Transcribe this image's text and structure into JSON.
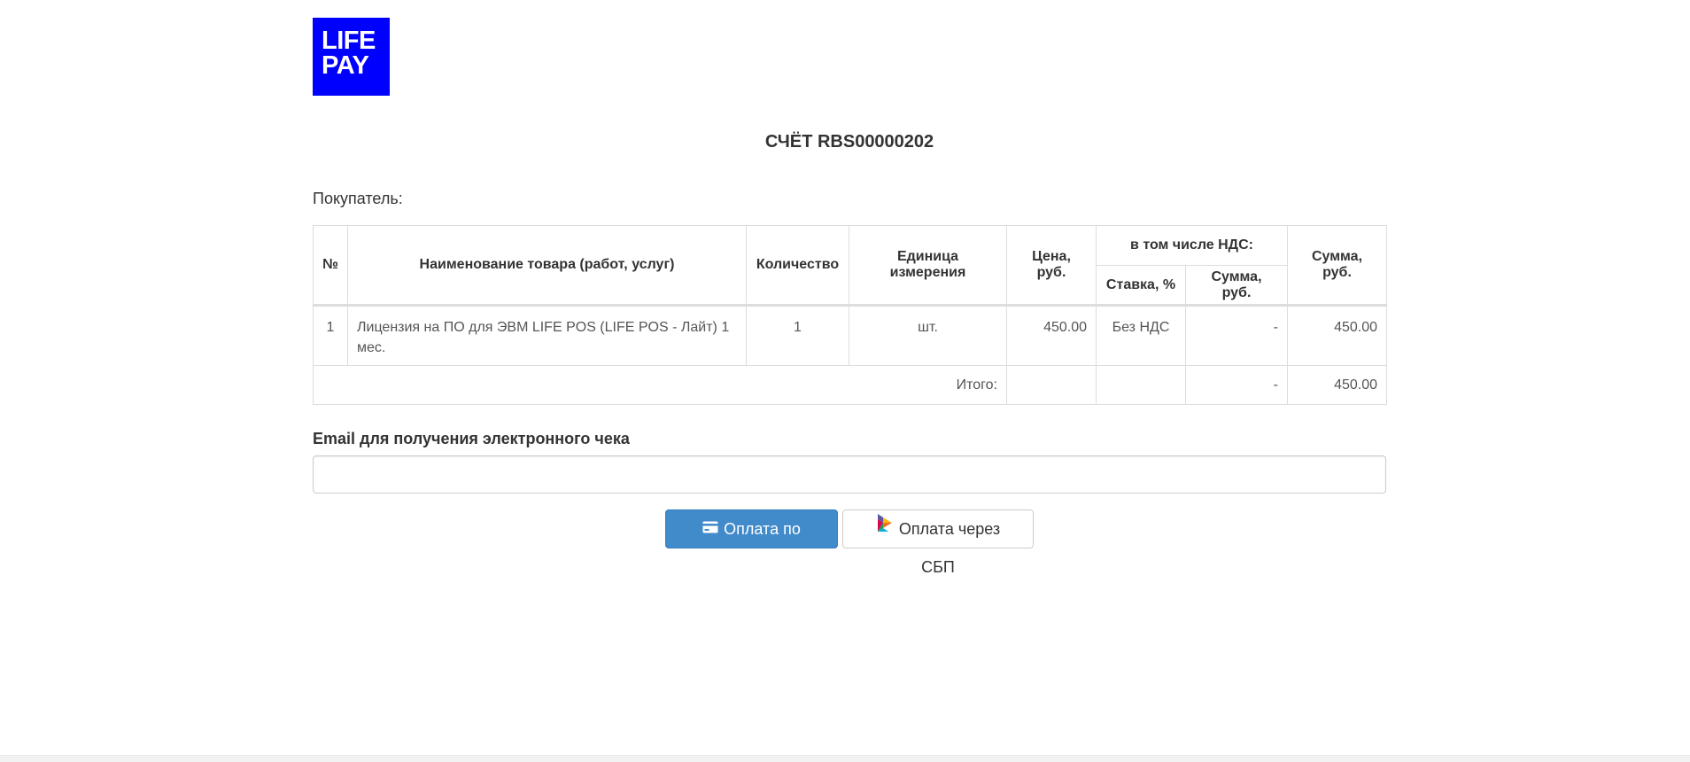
{
  "logo": {
    "line1": "LIFE",
    "line2": "PAY",
    "color": "#0000ff"
  },
  "invoice": {
    "title": "СЧЁТ RBS00000202",
    "buyer_label": "Покупатель:"
  },
  "table": {
    "headers": {
      "num": "№",
      "name": "Наименование товара (работ, услуг)",
      "qty": "Количество",
      "unit": "Единица измерения",
      "price": "Цена, руб.",
      "vat_group": "в том числе НДС:",
      "vat_rate": "Ставка, %",
      "vat_sum": "Сумма, руб.",
      "sum": "Сумма, руб."
    },
    "rows": [
      {
        "num": "1",
        "name": "Лицензия на ПО для ЭВМ LIFE POS (LIFE POS - Лайт) 1 мес.",
        "qty": "1",
        "unit": "шт.",
        "price": "450.00",
        "vat_rate": "Без НДС",
        "vat_sum": "-",
        "sum": "450.00"
      }
    ],
    "total": {
      "label": "Итого:",
      "price": "",
      "vat_rate": "",
      "vat_sum": "-",
      "sum": "450.00"
    }
  },
  "email": {
    "label": "Email для получения электронного чека",
    "value": "",
    "placeholder": ""
  },
  "buttons": {
    "card": {
      "label": "Оплата по карте",
      "icon": "credit-card-icon",
      "color": "#428bca"
    },
    "sbp": {
      "label": "Оплата через СБП",
      "icon": "sbp-logo-icon"
    }
  }
}
